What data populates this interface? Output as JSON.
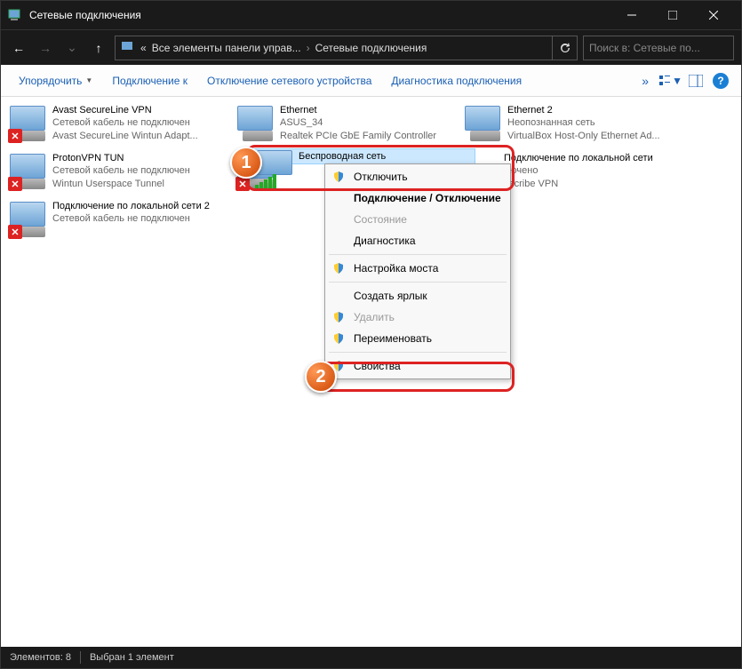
{
  "window": {
    "title": "Сетевые подключения"
  },
  "nav": {
    "crumb1": "Все элементы панели управ...",
    "crumb2": "Сетевые подключения",
    "refresh_icon": "refresh",
    "search_placeholder": "Поиск в: Сетевые по..."
  },
  "toolbar": {
    "organize": "Упорядочить",
    "connect": "Подключение к",
    "disable": "Отключение сетевого устройства",
    "diagnose": "Диагностика подключения"
  },
  "connections": {
    "c0": {
      "name": "Avast SecureLine VPN",
      "line2": "Сетевой кабель не подключен",
      "line3": "Avast SecureLine Wintun Adapt..."
    },
    "c1": {
      "name": "Ethernet",
      "line2": "ASUS_34",
      "line3": "Realtek PCIe GbE Family Controller"
    },
    "c2": {
      "name": "Ethernet 2",
      "line2": "Неопознанная сеть",
      "line3": "VirtualBox Host-Only Ethernet Ad..."
    },
    "c3": {
      "name": "ProtonVPN TUN",
      "line2": "Сетевой кабель не подключен",
      "line3": "Wintun Userspace Tunnel"
    },
    "c4": {
      "name": "Беспроводная сеть",
      "line2": "",
      "line3": ""
    },
    "c5": {
      "name": "Подключение по локальной сети",
      "line2": "лючено",
      "line3": "dscribe VPN"
    },
    "c6": {
      "name": "Подключение по локальной сети 2",
      "line2": "Сетевой кабель не подключен",
      "line3": ""
    }
  },
  "context_menu": {
    "disconnect": "Отключить",
    "connect_disconnect": "Подключение / Отключение",
    "status": "Состояние",
    "diag": "Диагностика",
    "bridge": "Настройка моста",
    "shortcut": "Создать ярлык",
    "delete": "Удалить",
    "rename": "Переименовать",
    "properties": "Свойства"
  },
  "badges": {
    "b1": "1",
    "b2": "2"
  },
  "status": {
    "elements": "Элементов: 8",
    "selected": "Выбран 1 элемент"
  }
}
